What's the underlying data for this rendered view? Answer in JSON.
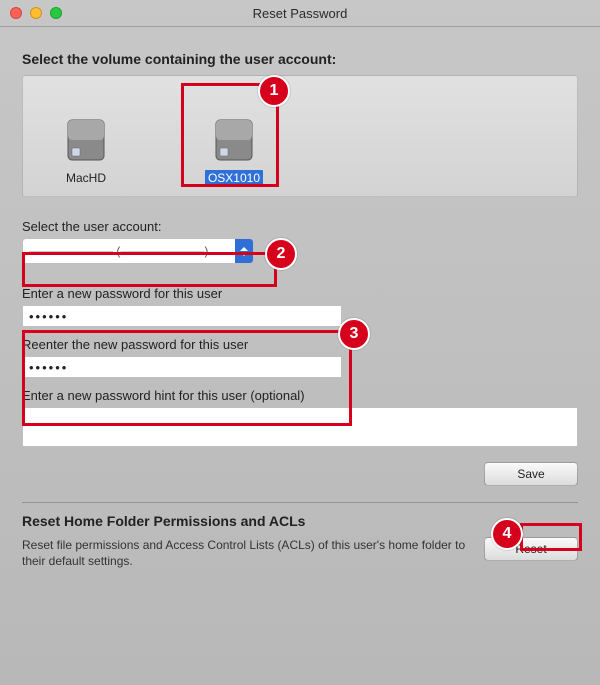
{
  "window": {
    "title": "Reset Password"
  },
  "volume": {
    "heading": "Select the volume containing the user account:",
    "items": [
      {
        "label": "MacHD",
        "selected": false
      },
      {
        "label": "OSX1010",
        "selected": true
      }
    ]
  },
  "account": {
    "heading": "Select the user account:",
    "selected_text": "——————— (———————)"
  },
  "password": {
    "new_label": "Enter a new password for this user",
    "new_value": "••••••",
    "confirm_label": "Reenter the new password for this user",
    "confirm_value": "••••••",
    "hint_label": "Enter a new password hint for this user (optional)",
    "hint_value": ""
  },
  "buttons": {
    "save": "Save",
    "reset": "Reset"
  },
  "acl": {
    "heading": "Reset Home Folder Permissions and ACLs",
    "body": "Reset file permissions and Access Control Lists (ACLs) of this user's home folder to their default settings."
  },
  "annotations": {
    "1": "1",
    "2": "2",
    "3": "3",
    "4": "4"
  },
  "colors": {
    "annotation": "#d6001c",
    "accent": "#2f6fd8"
  }
}
